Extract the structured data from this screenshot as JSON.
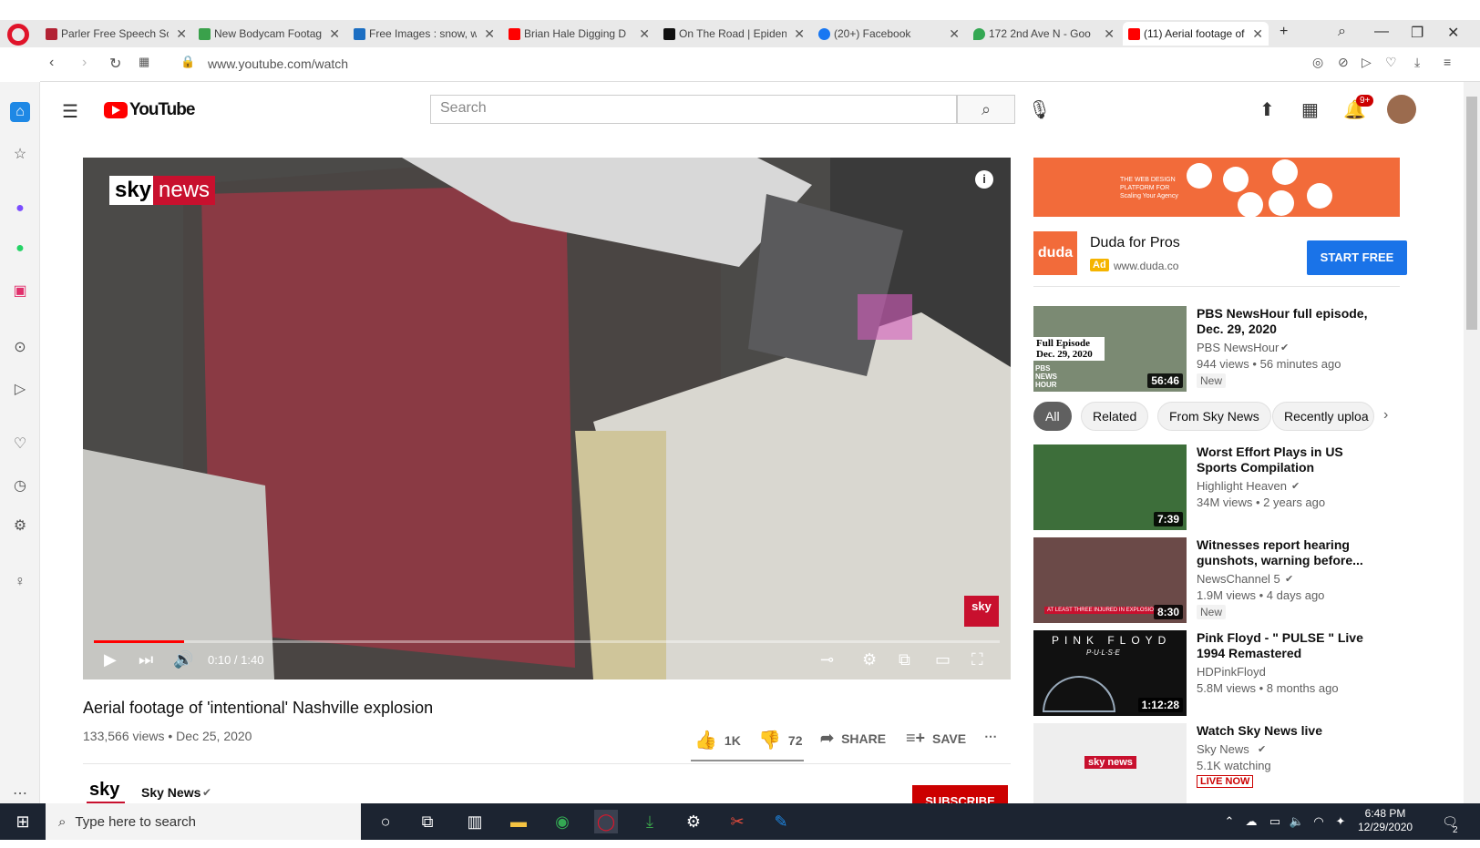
{
  "browser": {
    "tabs": [
      {
        "label": "Parler Free Speech So",
        "color": "#b22234"
      },
      {
        "label": "New Bodycam Footag",
        "color": "#3aa14b"
      },
      {
        "label": "Free Images : snow, w",
        "color": "#1b6ec2"
      },
      {
        "label": "Brian Hale Digging D",
        "color": "#ff0000"
      },
      {
        "label": "On The Road | Epiden",
        "color": "#111111"
      },
      {
        "label": "(20+) Facebook",
        "color": "#1877f2"
      },
      {
        "label": "172 2nd Ave N - Goo",
        "color": "#34a853"
      },
      {
        "label": "(11) Aerial footage of",
        "color": "#ff0000"
      }
    ],
    "url": "www.youtube.com/watch"
  },
  "youtube": {
    "logo_text": "YouTube",
    "search_placeholder": "Search",
    "notif_count": "9+"
  },
  "player": {
    "time": "0:10 / 1:40",
    "progress_fraction": 0.1,
    "watermark_brand": "sky",
    "watermark_news": "news"
  },
  "video": {
    "title": "Aerial footage of 'intentional' Nashville explosion",
    "meta": "133,566 views • Dec 25, 2020",
    "likes": "1K",
    "dislikes": "72",
    "share": "SHARE",
    "save": "SAVE",
    "channel": "Sky News",
    "subscribe": "SUBSCRIBE"
  },
  "ad": {
    "title": "Duda for Pros",
    "badge": "Ad",
    "url": "www.duda.co",
    "cta": "START FREE",
    "logo_text": "duda",
    "banner_text": "THE WEB DESIGN PLATFORM FOR Scaling Your Agency"
  },
  "recommendations": [
    {
      "title": "PBS NewsHour full episode, Dec. 29, 2020",
      "channel": "PBS NewsHour",
      "views": "944 views • 56 minutes ago",
      "duration": "56:46",
      "badge": "New",
      "thumb_text": "Full Episode Dec. 29, 2020",
      "brand": "PBS NEWS HOUR"
    },
    {
      "title": "Worst Effort Plays in US Sports Compilation",
      "channel": "Highlight Heaven",
      "views": "34M views • 2 years ago",
      "duration": "7:39",
      "badge": ""
    },
    {
      "title": "Witnesses report hearing gunshots, warning before...",
      "channel": "NewsChannel 5",
      "views": "1.9M views • 4 days ago",
      "duration": "8:30",
      "badge": "New",
      "thumb_text": "AT LEAST THREE INJURED IN EXPLOSION"
    },
    {
      "title": "Pink Floyd - \" PULSE \" Live 1994 Remastered",
      "channel": "HDPinkFloyd",
      "views": "5.8M views • 8 months ago",
      "duration": "1:12:28",
      "badge": "",
      "thumb_text": "PINK FLOYD",
      "thumb_sub": "P·U·L·S·E"
    },
    {
      "title": "Watch Sky News live",
      "channel": "Sky News",
      "views": "5.1K watching",
      "duration": "",
      "badge": "LIVE NOW",
      "thumb_text": "sky news"
    }
  ],
  "chips": [
    "All",
    "Related",
    "From Sky News",
    "Recently uploa"
  ],
  "taskbar": {
    "search_placeholder": "Type here to search",
    "time": "6:48 PM",
    "date": "12/29/2020",
    "notif": "2"
  }
}
